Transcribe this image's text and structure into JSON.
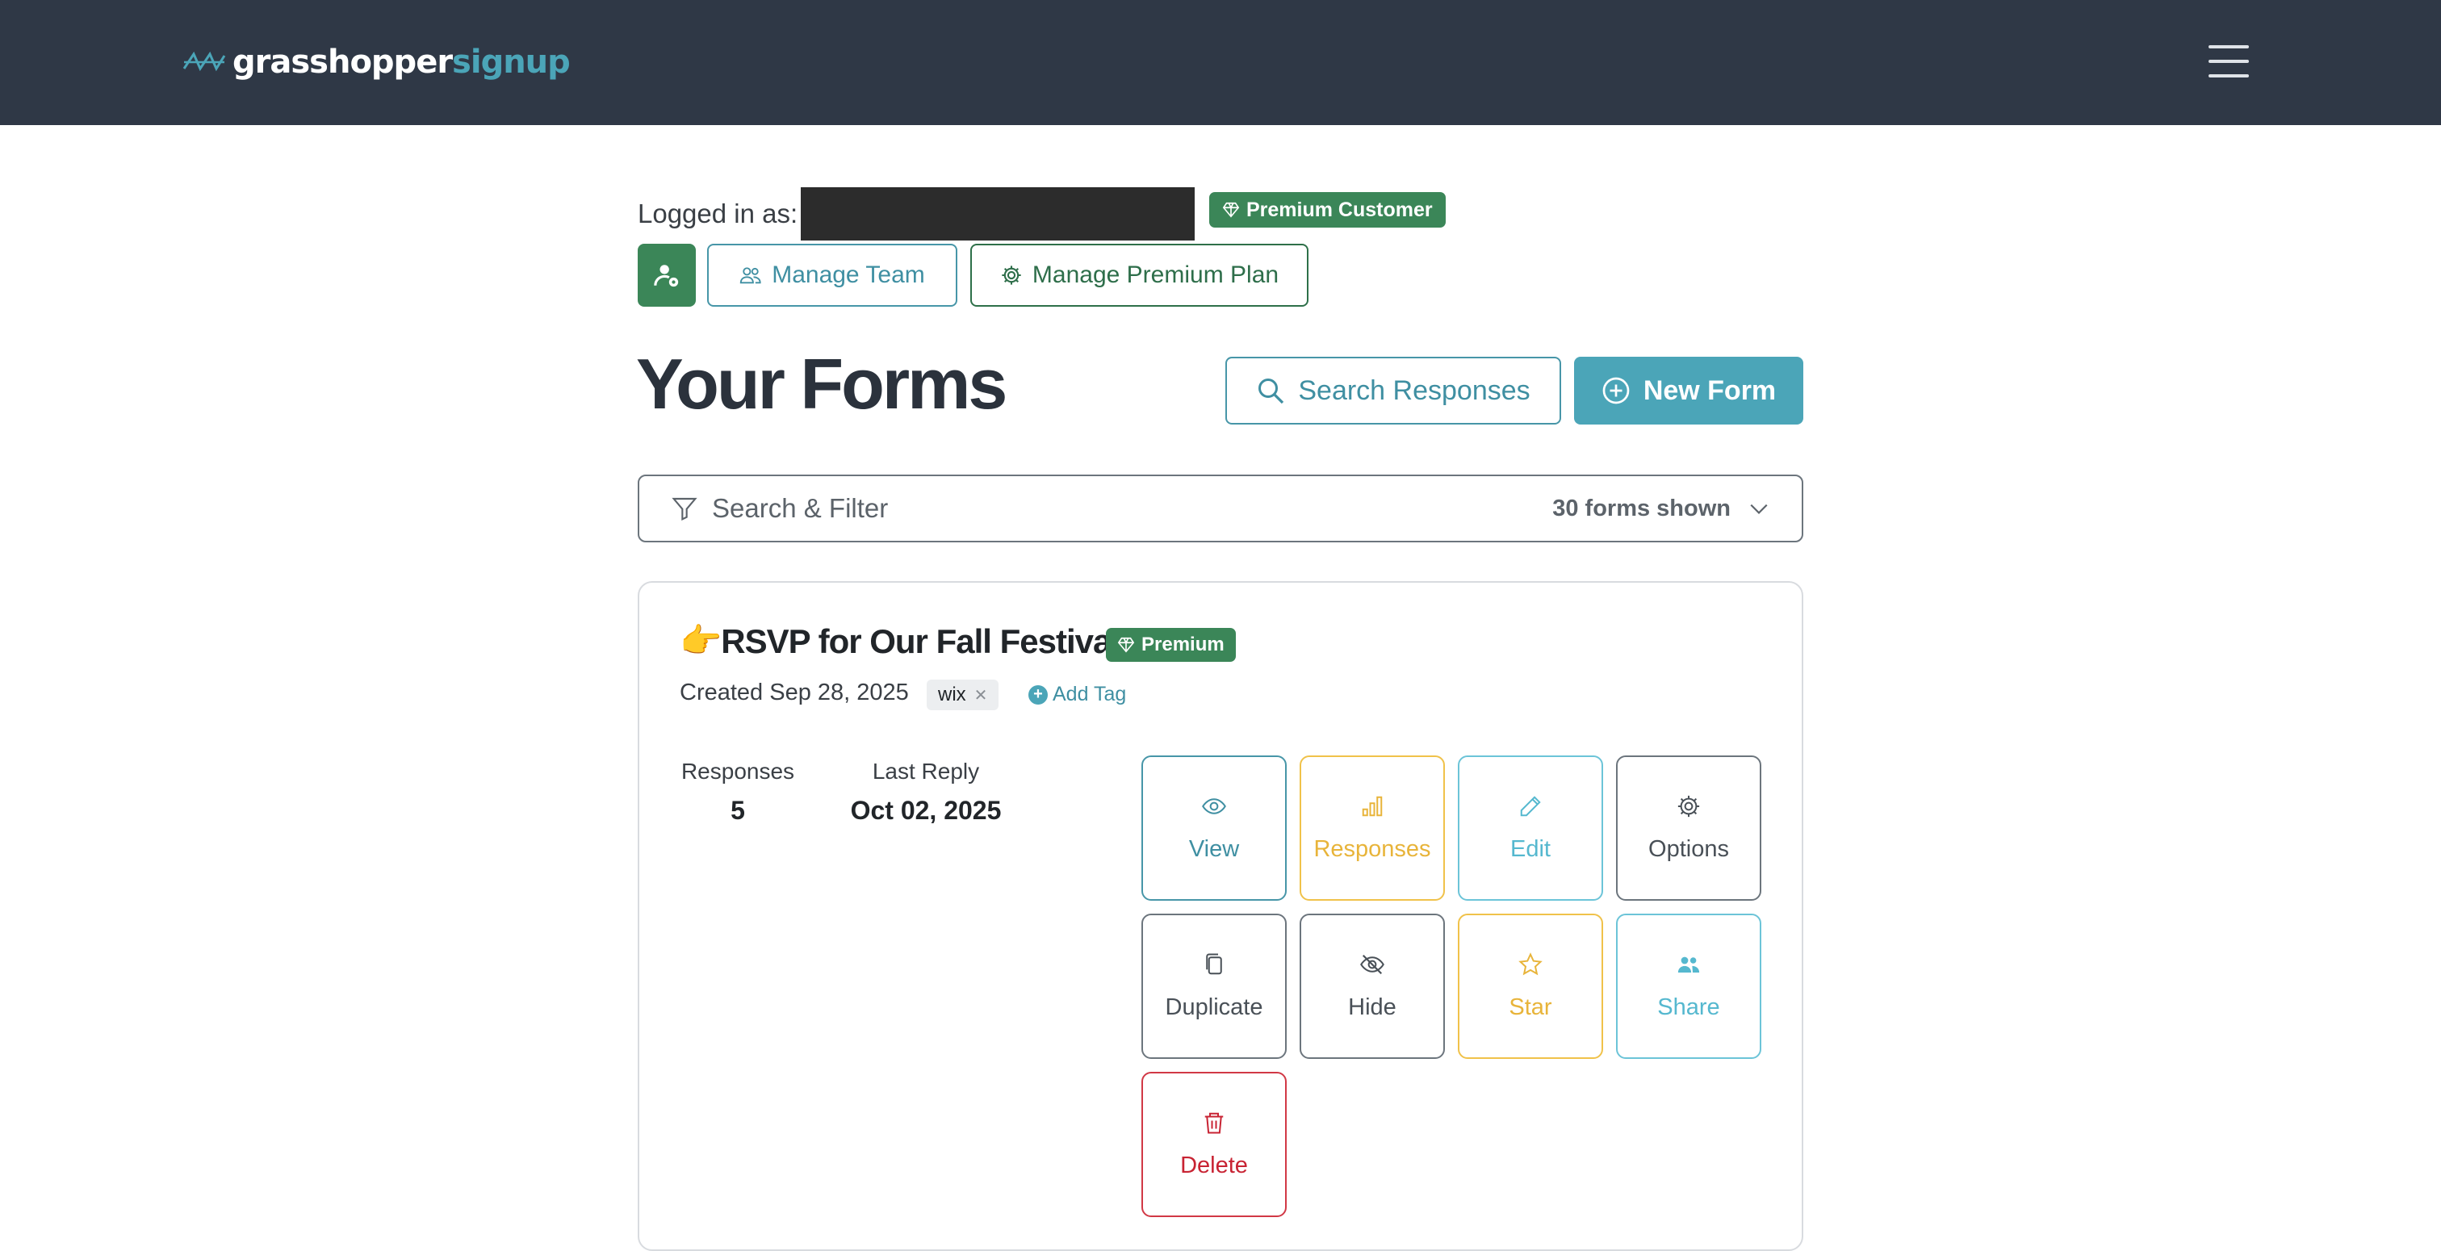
{
  "header": {
    "brand_first": "grasshopper",
    "brand_second": "signup",
    "menu_icon": "hamburger-menu-icon"
  },
  "account": {
    "logged_in_label": "Logged in as:",
    "status_badge": "Premium Customer",
    "manage_team": "Manage Team",
    "manage_plan": "Manage Premium Plan"
  },
  "main": {
    "title": "Your Forms",
    "search_responses": "Search Responses",
    "new_form": "New Form"
  },
  "filter": {
    "label": "Search & Filter",
    "count": "30 forms shown"
  },
  "form": {
    "emoji": "👉",
    "title": "RSVP for Our Fall Festival!",
    "badge": "Premium",
    "created": "Created Sep 28, 2025",
    "tags": [
      "wix"
    ],
    "add_tag": "Add Tag",
    "responses_label": "Responses",
    "responses_value": "5",
    "last_reply_label": "Last Reply",
    "last_reply_value": "Oct 02, 2025",
    "actions": [
      {
        "label": "View",
        "icon": "eye-icon"
      },
      {
        "label": "Responses",
        "icon": "bar-chart-icon"
      },
      {
        "label": "Edit",
        "icon": "pencil-icon"
      },
      {
        "label": "Options",
        "icon": "gear-icon"
      },
      {
        "label": "Duplicate",
        "icon": "copy-icon"
      },
      {
        "label": "Hide",
        "icon": "eye-slash-icon"
      },
      {
        "label": "Star",
        "icon": "star-icon"
      },
      {
        "label": "Share",
        "icon": "people-icon"
      },
      {
        "label": "Delete",
        "icon": "trash-icon"
      }
    ]
  },
  "colors": {
    "header_bg": "#2f3846",
    "brand_accent": "#4ba5b8",
    "premium_green": "#3b8658",
    "danger": "#d13845",
    "warning": "#f0c24a"
  }
}
